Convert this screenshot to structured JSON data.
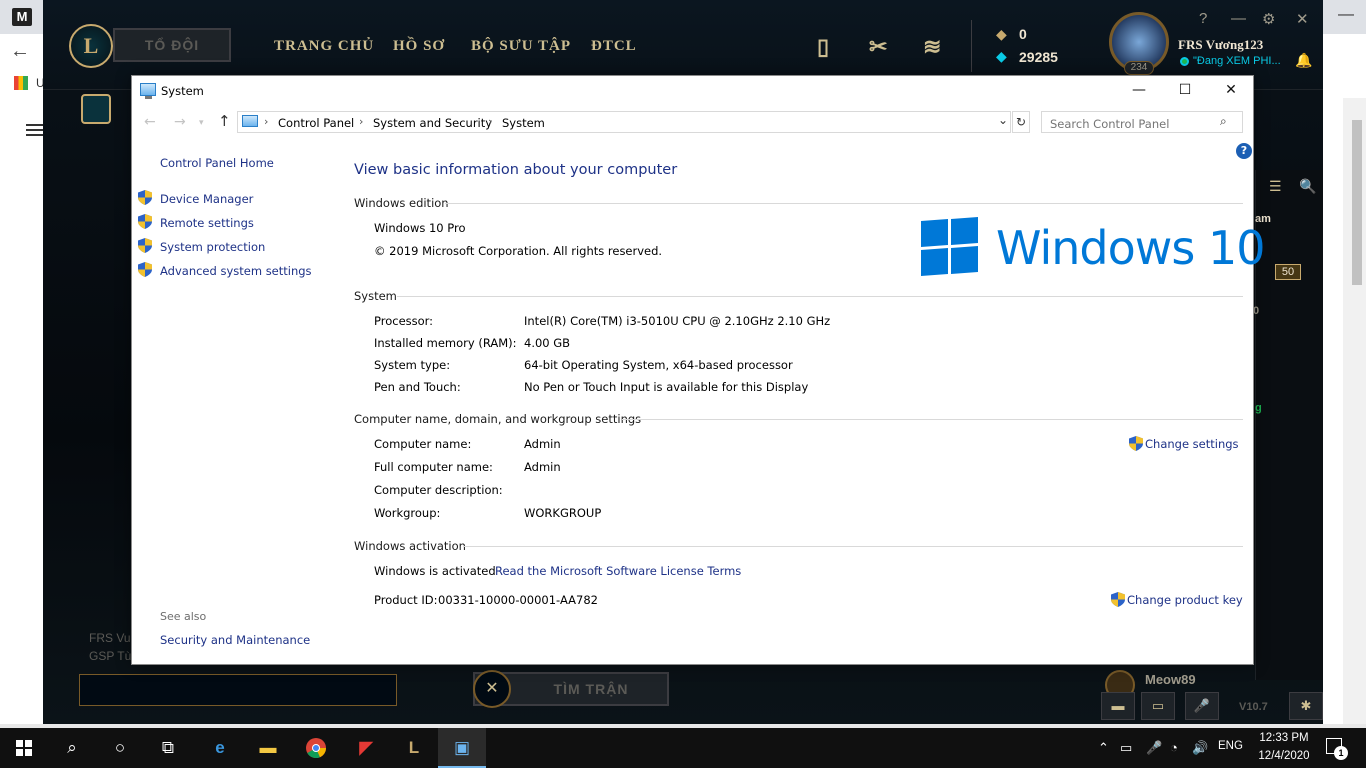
{
  "browser": {
    "logo_letter": "M",
    "back_glyph": "←",
    "apps_label": "U",
    "close_glyph": "✕",
    "minimize_glyph": "—"
  },
  "league": {
    "logo_letter": "L",
    "party_button": "TỔ ĐỘI",
    "nav": [
      "TRANG CHỦ",
      "HỒ SƠ",
      "BỘ SƯU TẬP",
      "ĐTCL"
    ],
    "currency": {
      "rp": "0",
      "be": "29285"
    },
    "level": "234",
    "username": "FRS Vương123",
    "status": "\"Đang XEM PHI...",
    "window_controls": [
      "?",
      "—",
      "⚙",
      "✕"
    ],
    "right_panel": {
      "text_am": "am",
      "badge": "50",
      "text_0": "0",
      "text_g": "g"
    },
    "bottom_text": [
      "FRS Vu",
      "GSP Tù"
    ],
    "find_match": "TÌM TRẬN",
    "friend_name": "Meow89",
    "version": "V10.7"
  },
  "system_window": {
    "title": "System",
    "controls": {
      "minimize": "—",
      "maximize": "☐",
      "close": "✕"
    },
    "breadcrumbs": [
      "Control Panel",
      "System and Security",
      "System"
    ],
    "search_placeholder": "Search Control Panel",
    "help": "?",
    "left_pane": {
      "home": "Control Panel Home",
      "links": [
        "Device Manager",
        "Remote settings",
        "System protection",
        "Advanced system settings"
      ],
      "see_also": "See also",
      "see_also_links": [
        "Security and Maintenance"
      ]
    },
    "heading": "View basic information about your computer",
    "edition": {
      "title": "Windows edition",
      "name": "Windows 10 Pro",
      "copyright": "© 2019 Microsoft Corporation. All rights reserved.",
      "logo_text": "Windows 10"
    },
    "system": {
      "title": "System",
      "rows": [
        {
          "label": "Processor:",
          "value": "Intel(R) Core(TM) i3-5010U CPU @ 2.10GHz   2.10 GHz"
        },
        {
          "label": "Installed memory (RAM):",
          "value": "4.00 GB"
        },
        {
          "label": "System type:",
          "value": "64-bit Operating System, x64-based processor"
        },
        {
          "label": "Pen and Touch:",
          "value": "No Pen or Touch Input is available for this Display"
        }
      ]
    },
    "computer_name": {
      "title": "Computer name, domain, and workgroup settings",
      "rows": [
        {
          "label": "Computer name:",
          "value": "Admin"
        },
        {
          "label": "Full computer name:",
          "value": "Admin"
        },
        {
          "label": "Computer description:",
          "value": ""
        },
        {
          "label": "Workgroup:",
          "value": "WORKGROUP"
        }
      ],
      "change_settings": "Change settings"
    },
    "activation": {
      "title": "Windows activation",
      "status": "Windows is activated",
      "license_link": "Read the Microsoft Software License Terms",
      "product_id_label": "Product ID:",
      "product_id": "00331-10000-00001-AA782",
      "change_key": "Change product key"
    }
  },
  "taskbar": {
    "language": "ENG",
    "time": "12:33 PM",
    "date": "12/4/2020",
    "notification_count": "1"
  },
  "colors": {
    "link_blue": "#1e3287",
    "windows_blue": "#0078d7",
    "league_gold": "#c8aa6e",
    "taskbar": "#101010"
  }
}
